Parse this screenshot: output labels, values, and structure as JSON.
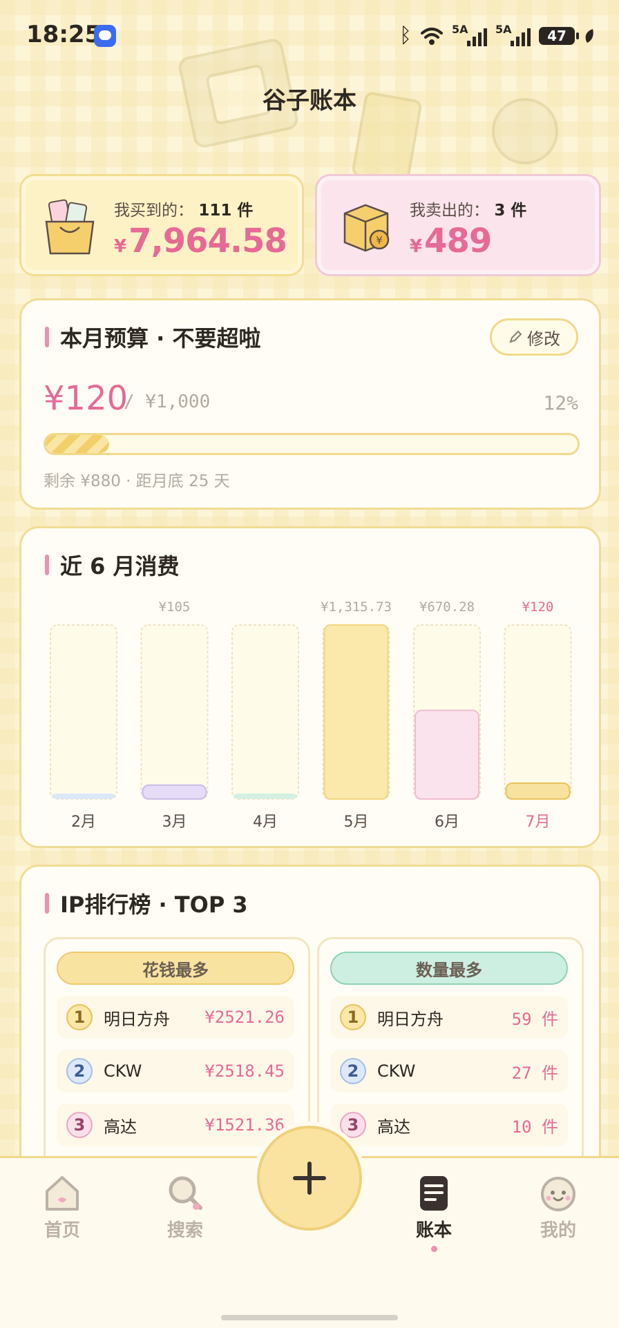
{
  "status_bar": {
    "time": "18:25",
    "signal1": "5A",
    "signal2": "5A",
    "battery": "47"
  },
  "header": {
    "title": "谷子账本"
  },
  "summary": {
    "bought": {
      "label": "我买到的：",
      "count": "111 件",
      "amount": "7,964.58",
      "yen": "¥"
    },
    "sold": {
      "label": "我卖出的：",
      "count": "3 件",
      "amount": "489",
      "yen": "¥"
    }
  },
  "budget": {
    "title": "本月预算 · 不要超啦",
    "edit_label": "修改",
    "spent": "¥120",
    "total": "/ ¥1,000",
    "percent": "12%",
    "progress_fraction": 0.12,
    "remaining_text": "剩余 ¥880 · 距月底 25 天"
  },
  "chart_data": {
    "type": "bar",
    "title": "近 6 月消费",
    "categories": [
      "2月",
      "3月",
      "4月",
      "5月",
      "6月",
      "7月"
    ],
    "values": [
      0,
      105,
      0,
      1315.73,
      670.28,
      120
    ],
    "value_labels": [
      "",
      "¥105",
      "",
      "¥1,315.73",
      "¥670.28",
      "¥120"
    ],
    "highlight_category": "7月",
    "bar_colors": [
      "#dce8f8",
      "#e6dcf8",
      "#d4f0e2",
      "#fbe8ab",
      "#fbe3ee",
      "#f8e2a0"
    ],
    "ylim": [
      0,
      1315.73
    ]
  },
  "ranking": {
    "title": "IP排行榜 · TOP 3",
    "by_money": {
      "header": "花钱最多",
      "items": [
        {
          "rank": "1",
          "name": "明日方舟",
          "value": "¥2521.26"
        },
        {
          "rank": "2",
          "name": "CKW",
          "value": "¥2518.45"
        },
        {
          "rank": "3",
          "name": "高达",
          "value": "¥1521.36"
        }
      ]
    },
    "by_count": {
      "header": "数量最多",
      "items": [
        {
          "rank": "1",
          "name": "明日方舟",
          "value": "59 件"
        },
        {
          "rank": "2",
          "name": "CKW",
          "value": "27 件"
        },
        {
          "rank": "3",
          "name": "高达",
          "value": "10 件"
        }
      ]
    }
  },
  "nav": {
    "home": "首页",
    "search": "搜索",
    "ledger": "账本",
    "mine": "我的",
    "active": "账本"
  }
}
